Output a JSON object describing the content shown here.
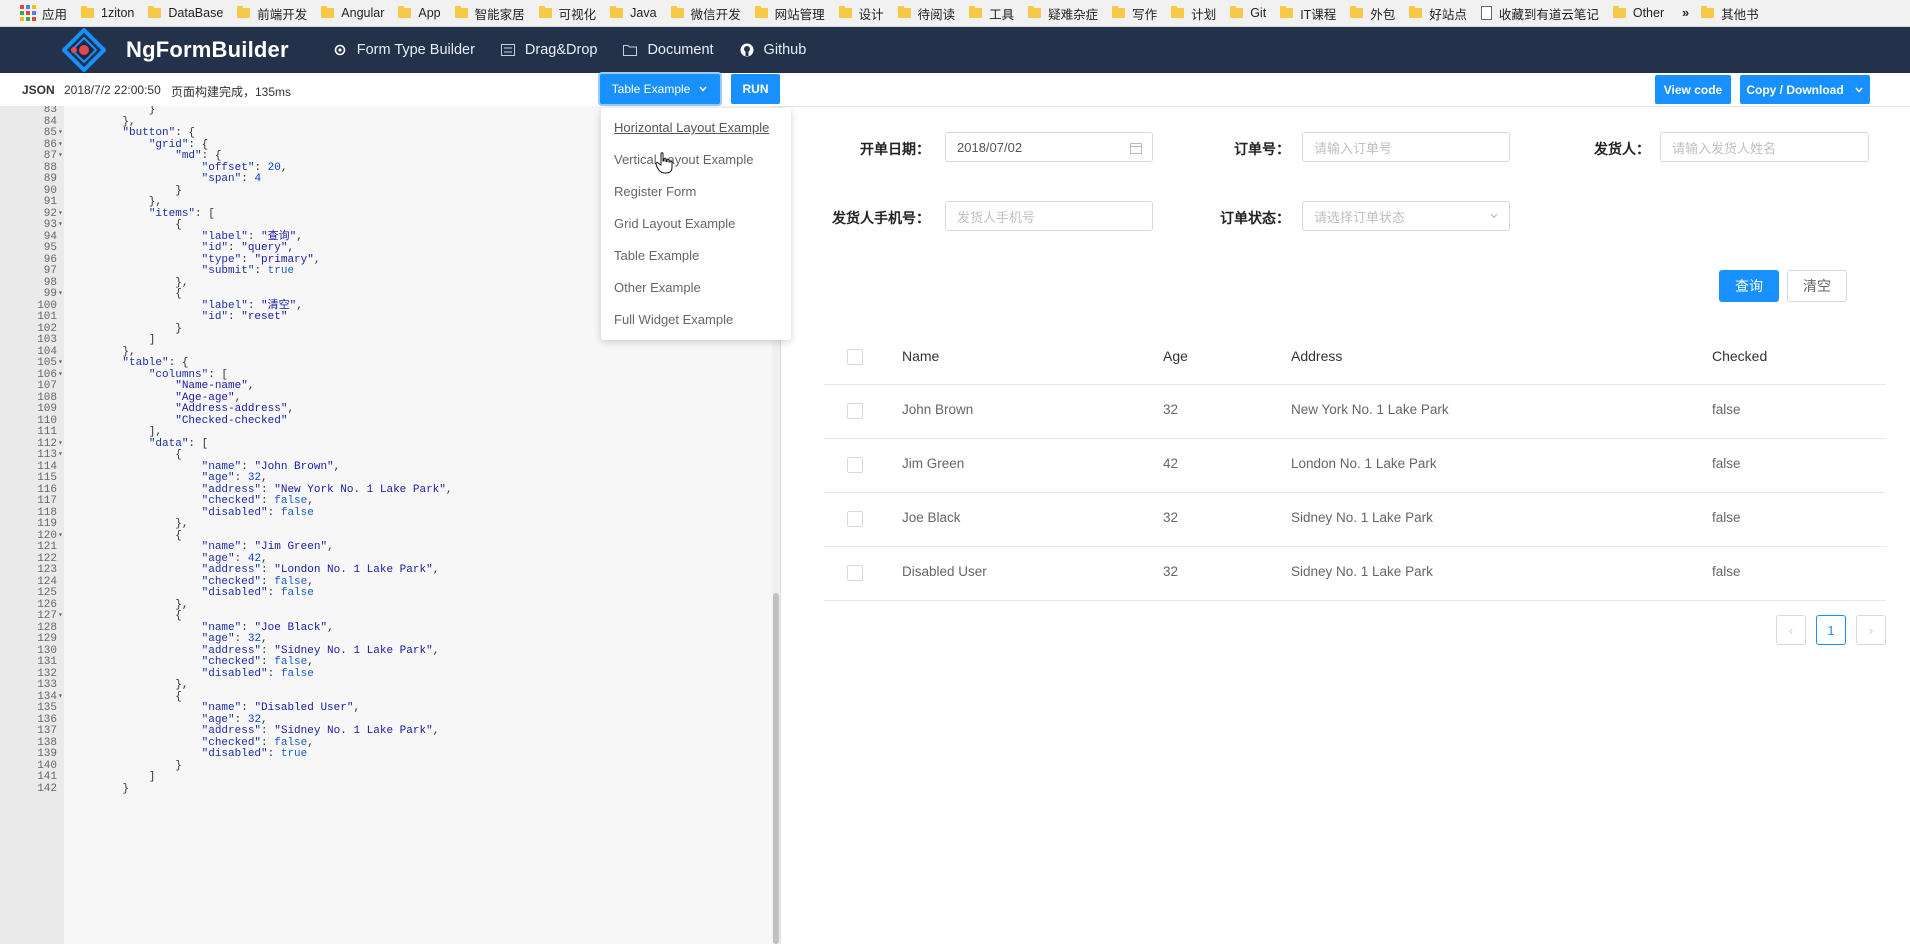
{
  "bookmarks": {
    "apps_label": "应用",
    "items": [
      {
        "label": "1ziton",
        "kind": "folder"
      },
      {
        "label": "DataBase",
        "kind": "folder"
      },
      {
        "label": "前端开发",
        "kind": "folder"
      },
      {
        "label": "Angular",
        "kind": "folder"
      },
      {
        "label": "App",
        "kind": "folder"
      },
      {
        "label": "智能家居",
        "kind": "folder"
      },
      {
        "label": "可视化",
        "kind": "folder"
      },
      {
        "label": "Java",
        "kind": "folder"
      },
      {
        "label": "微信开发",
        "kind": "folder"
      },
      {
        "label": "网站管理",
        "kind": "folder"
      },
      {
        "label": "设计",
        "kind": "folder"
      },
      {
        "label": "待阅读",
        "kind": "folder"
      },
      {
        "label": "工具",
        "kind": "folder"
      },
      {
        "label": "疑难杂症",
        "kind": "folder"
      },
      {
        "label": "写作",
        "kind": "folder"
      },
      {
        "label": "计划",
        "kind": "folder"
      },
      {
        "label": "Git",
        "kind": "folder"
      },
      {
        "label": "IT课程",
        "kind": "folder"
      },
      {
        "label": "外包",
        "kind": "folder"
      },
      {
        "label": "好站点",
        "kind": "folder"
      },
      {
        "label": "收藏到有道云笔记",
        "kind": "page"
      },
      {
        "label": "Other",
        "kind": "folder"
      }
    ],
    "overflow": "»",
    "other_bookmarks": "其他书"
  },
  "navbar": {
    "brand": "NgFormBuilder",
    "items": [
      {
        "label": "Form Type Builder",
        "icon": "gear-icon"
      },
      {
        "label": "Drag&Drop",
        "icon": "list-icon"
      },
      {
        "label": "Document",
        "icon": "folder-icon"
      },
      {
        "label": "Github",
        "icon": "github-icon"
      }
    ]
  },
  "toolbar": {
    "mode_label": "JSON",
    "timestamp": "2018/7/2 22:00:50",
    "status": "页面构建完成，135ms",
    "example_select": "Table Example",
    "run_label": "RUN",
    "view_code_label": "View code",
    "copy_label": "Copy / Download"
  },
  "dropdown": {
    "items": [
      "Horizontal Layout Example",
      "Vertical Layout Example",
      "Register Form",
      "Grid Layout Example",
      "Table Example",
      "Other Example",
      "Full Widget Example"
    ],
    "hovered": "Horizontal Layout Example"
  },
  "editor": {
    "lines": [
      {
        "n": "83",
        "fold": false,
        "code": "        }"
      },
      {
        "n": "84",
        "fold": false,
        "code": "    },"
      },
      {
        "n": "85",
        "fold": true,
        "code": "    \"button\": {"
      },
      {
        "n": "86",
        "fold": true,
        "code": "        \"grid\": {"
      },
      {
        "n": "87",
        "fold": true,
        "code": "            \"md\": {"
      },
      {
        "n": "88",
        "fold": false,
        "code": "                \"offset\": 20,"
      },
      {
        "n": "89",
        "fold": false,
        "code": "                \"span\": 4"
      },
      {
        "n": "90",
        "fold": false,
        "code": "            }"
      },
      {
        "n": "91",
        "fold": false,
        "code": "        },"
      },
      {
        "n": "92",
        "fold": true,
        "code": "        \"items\": ["
      },
      {
        "n": "93",
        "fold": true,
        "code": "            {"
      },
      {
        "n": "94",
        "fold": false,
        "code": "                \"label\": \"查询\","
      },
      {
        "n": "95",
        "fold": false,
        "code": "                \"id\": \"query\","
      },
      {
        "n": "96",
        "fold": false,
        "code": "                \"type\": \"primary\","
      },
      {
        "n": "97",
        "fold": false,
        "code": "                \"submit\": true"
      },
      {
        "n": "98",
        "fold": false,
        "code": "            },"
      },
      {
        "n": "99",
        "fold": true,
        "code": "            {"
      },
      {
        "n": "100",
        "fold": false,
        "code": "                \"label\": \"清空\","
      },
      {
        "n": "101",
        "fold": false,
        "code": "                \"id\": \"reset\""
      },
      {
        "n": "102",
        "fold": false,
        "code": "            }"
      },
      {
        "n": "103",
        "fold": false,
        "code": "        ]"
      },
      {
        "n": "104",
        "fold": false,
        "code": "    },"
      },
      {
        "n": "105",
        "fold": true,
        "code": "    \"table\": {"
      },
      {
        "n": "106",
        "fold": true,
        "code": "        \"columns\": ["
      },
      {
        "n": "107",
        "fold": false,
        "code": "            \"Name-name\","
      },
      {
        "n": "108",
        "fold": false,
        "code": "            \"Age-age\","
      },
      {
        "n": "109",
        "fold": false,
        "code": "            \"Address-address\","
      },
      {
        "n": "110",
        "fold": false,
        "code": "            \"Checked-checked\""
      },
      {
        "n": "111",
        "fold": false,
        "code": "        ],"
      },
      {
        "n": "112",
        "fold": true,
        "code": "        \"data\": ["
      },
      {
        "n": "113",
        "fold": true,
        "code": "            {"
      },
      {
        "n": "114",
        "fold": false,
        "code": "                \"name\": \"John Brown\","
      },
      {
        "n": "115",
        "fold": false,
        "code": "                \"age\": 32,"
      },
      {
        "n": "116",
        "fold": false,
        "code": "                \"address\": \"New York No. 1 Lake Park\","
      },
      {
        "n": "117",
        "fold": false,
        "code": "                \"checked\": false,"
      },
      {
        "n": "118",
        "fold": false,
        "code": "                \"disabled\": false"
      },
      {
        "n": "119",
        "fold": false,
        "code": "            },"
      },
      {
        "n": "120",
        "fold": true,
        "code": "            {"
      },
      {
        "n": "121",
        "fold": false,
        "code": "                \"name\": \"Jim Green\","
      },
      {
        "n": "122",
        "fold": false,
        "code": "                \"age\": 42,"
      },
      {
        "n": "123",
        "fold": false,
        "code": "                \"address\": \"London No. 1 Lake Park\","
      },
      {
        "n": "124",
        "fold": false,
        "code": "                \"checked\": false,"
      },
      {
        "n": "125",
        "fold": false,
        "code": "                \"disabled\": false"
      },
      {
        "n": "126",
        "fold": false,
        "code": "            },"
      },
      {
        "n": "127",
        "fold": true,
        "code": "            {"
      },
      {
        "n": "128",
        "fold": false,
        "code": "                \"name\": \"Joe Black\","
      },
      {
        "n": "129",
        "fold": false,
        "code": "                \"age\": 32,"
      },
      {
        "n": "130",
        "fold": false,
        "code": "                \"address\": \"Sidney No. 1 Lake Park\","
      },
      {
        "n": "131",
        "fold": false,
        "code": "                \"checked\": false,"
      },
      {
        "n": "132",
        "fold": false,
        "code": "                \"disabled\": false"
      },
      {
        "n": "133",
        "fold": false,
        "code": "            },"
      },
      {
        "n": "134",
        "fold": true,
        "code": "            {"
      },
      {
        "n": "135",
        "fold": false,
        "code": "                \"name\": \"Disabled User\","
      },
      {
        "n": "136",
        "fold": false,
        "code": "                \"age\": 32,"
      },
      {
        "n": "137",
        "fold": false,
        "code": "                \"address\": \"Sidney No. 1 Lake Park\","
      },
      {
        "n": "138",
        "fold": false,
        "code": "                \"checked\": false,"
      },
      {
        "n": "139",
        "fold": false,
        "code": "                \"disabled\": true"
      },
      {
        "n": "140",
        "fold": false,
        "code": "            }"
      },
      {
        "n": "141",
        "fold": false,
        "code": "        ]"
      },
      {
        "n": "142",
        "fold": false,
        "code": "    }"
      }
    ]
  },
  "form": {
    "start_date": {
      "label": "开单日期：",
      "value": "2018/07/02"
    },
    "order_no": {
      "label": "订单号：",
      "placeholder": "请输入订单号"
    },
    "shipper": {
      "label": "发货人：",
      "placeholder": "请输入发货人姓名"
    },
    "shipper_phone": {
      "label": "发货人手机号：",
      "placeholder": "发货人手机号"
    },
    "order_status": {
      "label": "订单状态：",
      "placeholder": "请选择订单状态"
    },
    "query_label": "查询",
    "reset_label": "清空"
  },
  "table": {
    "columns": [
      "Name",
      "Age",
      "Address",
      "Checked"
    ],
    "rows": [
      {
        "name": "John Brown",
        "age": "32",
        "address": "New York No. 1 Lake Park",
        "checked": "false"
      },
      {
        "name": "Jim Green",
        "age": "42",
        "address": "London No. 1 Lake Park",
        "checked": "false"
      },
      {
        "name": "Joe Black",
        "age": "32",
        "address": "Sidney No. 1 Lake Park",
        "checked": "false"
      },
      {
        "name": "Disabled User",
        "age": "32",
        "address": "Sidney No. 1 Lake Park",
        "checked": "false"
      }
    ]
  },
  "pagination": {
    "prev": "‹",
    "current": "1",
    "next": "›"
  },
  "colors": {
    "primary": "#1890ff",
    "navbar": "#23324a",
    "logo_red": "#e5484d"
  }
}
